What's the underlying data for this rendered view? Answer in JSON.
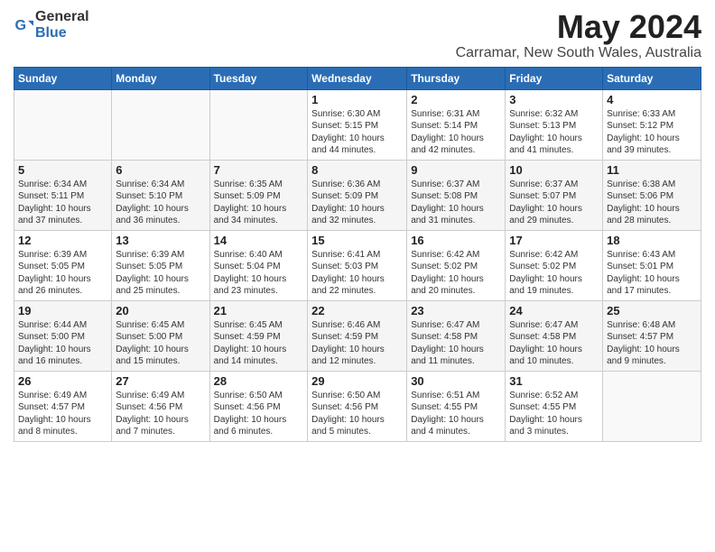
{
  "header": {
    "logo_general": "General",
    "logo_blue": "Blue",
    "title": "May 2024",
    "subtitle": "Carramar, New South Wales, Australia"
  },
  "weekdays": [
    "Sunday",
    "Monday",
    "Tuesday",
    "Wednesday",
    "Thursday",
    "Friday",
    "Saturday"
  ],
  "weeks": [
    [
      {
        "day": "",
        "info": ""
      },
      {
        "day": "",
        "info": ""
      },
      {
        "day": "",
        "info": ""
      },
      {
        "day": "1",
        "info": "Sunrise: 6:30 AM\nSunset: 5:15 PM\nDaylight: 10 hours\nand 44 minutes."
      },
      {
        "day": "2",
        "info": "Sunrise: 6:31 AM\nSunset: 5:14 PM\nDaylight: 10 hours\nand 42 minutes."
      },
      {
        "day": "3",
        "info": "Sunrise: 6:32 AM\nSunset: 5:13 PM\nDaylight: 10 hours\nand 41 minutes."
      },
      {
        "day": "4",
        "info": "Sunrise: 6:33 AM\nSunset: 5:12 PM\nDaylight: 10 hours\nand 39 minutes."
      }
    ],
    [
      {
        "day": "5",
        "info": "Sunrise: 6:34 AM\nSunset: 5:11 PM\nDaylight: 10 hours\nand 37 minutes."
      },
      {
        "day": "6",
        "info": "Sunrise: 6:34 AM\nSunset: 5:10 PM\nDaylight: 10 hours\nand 36 minutes."
      },
      {
        "day": "7",
        "info": "Sunrise: 6:35 AM\nSunset: 5:09 PM\nDaylight: 10 hours\nand 34 minutes."
      },
      {
        "day": "8",
        "info": "Sunrise: 6:36 AM\nSunset: 5:09 PM\nDaylight: 10 hours\nand 32 minutes."
      },
      {
        "day": "9",
        "info": "Sunrise: 6:37 AM\nSunset: 5:08 PM\nDaylight: 10 hours\nand 31 minutes."
      },
      {
        "day": "10",
        "info": "Sunrise: 6:37 AM\nSunset: 5:07 PM\nDaylight: 10 hours\nand 29 minutes."
      },
      {
        "day": "11",
        "info": "Sunrise: 6:38 AM\nSunset: 5:06 PM\nDaylight: 10 hours\nand 28 minutes."
      }
    ],
    [
      {
        "day": "12",
        "info": "Sunrise: 6:39 AM\nSunset: 5:05 PM\nDaylight: 10 hours\nand 26 minutes."
      },
      {
        "day": "13",
        "info": "Sunrise: 6:39 AM\nSunset: 5:05 PM\nDaylight: 10 hours\nand 25 minutes."
      },
      {
        "day": "14",
        "info": "Sunrise: 6:40 AM\nSunset: 5:04 PM\nDaylight: 10 hours\nand 23 minutes."
      },
      {
        "day": "15",
        "info": "Sunrise: 6:41 AM\nSunset: 5:03 PM\nDaylight: 10 hours\nand 22 minutes."
      },
      {
        "day": "16",
        "info": "Sunrise: 6:42 AM\nSunset: 5:02 PM\nDaylight: 10 hours\nand 20 minutes."
      },
      {
        "day": "17",
        "info": "Sunrise: 6:42 AM\nSunset: 5:02 PM\nDaylight: 10 hours\nand 19 minutes."
      },
      {
        "day": "18",
        "info": "Sunrise: 6:43 AM\nSunset: 5:01 PM\nDaylight: 10 hours\nand 17 minutes."
      }
    ],
    [
      {
        "day": "19",
        "info": "Sunrise: 6:44 AM\nSunset: 5:00 PM\nDaylight: 10 hours\nand 16 minutes."
      },
      {
        "day": "20",
        "info": "Sunrise: 6:45 AM\nSunset: 5:00 PM\nDaylight: 10 hours\nand 15 minutes."
      },
      {
        "day": "21",
        "info": "Sunrise: 6:45 AM\nSunset: 4:59 PM\nDaylight: 10 hours\nand 14 minutes."
      },
      {
        "day": "22",
        "info": "Sunrise: 6:46 AM\nSunset: 4:59 PM\nDaylight: 10 hours\nand 12 minutes."
      },
      {
        "day": "23",
        "info": "Sunrise: 6:47 AM\nSunset: 4:58 PM\nDaylight: 10 hours\nand 11 minutes."
      },
      {
        "day": "24",
        "info": "Sunrise: 6:47 AM\nSunset: 4:58 PM\nDaylight: 10 hours\nand 10 minutes."
      },
      {
        "day": "25",
        "info": "Sunrise: 6:48 AM\nSunset: 4:57 PM\nDaylight: 10 hours\nand 9 minutes."
      }
    ],
    [
      {
        "day": "26",
        "info": "Sunrise: 6:49 AM\nSunset: 4:57 PM\nDaylight: 10 hours\nand 8 minutes."
      },
      {
        "day": "27",
        "info": "Sunrise: 6:49 AM\nSunset: 4:56 PM\nDaylight: 10 hours\nand 7 minutes."
      },
      {
        "day": "28",
        "info": "Sunrise: 6:50 AM\nSunset: 4:56 PM\nDaylight: 10 hours\nand 6 minutes."
      },
      {
        "day": "29",
        "info": "Sunrise: 6:50 AM\nSunset: 4:56 PM\nDaylight: 10 hours\nand 5 minutes."
      },
      {
        "day": "30",
        "info": "Sunrise: 6:51 AM\nSunset: 4:55 PM\nDaylight: 10 hours\nand 4 minutes."
      },
      {
        "day": "31",
        "info": "Sunrise: 6:52 AM\nSunset: 4:55 PM\nDaylight: 10 hours\nand 3 minutes."
      },
      {
        "day": "",
        "info": ""
      }
    ]
  ]
}
